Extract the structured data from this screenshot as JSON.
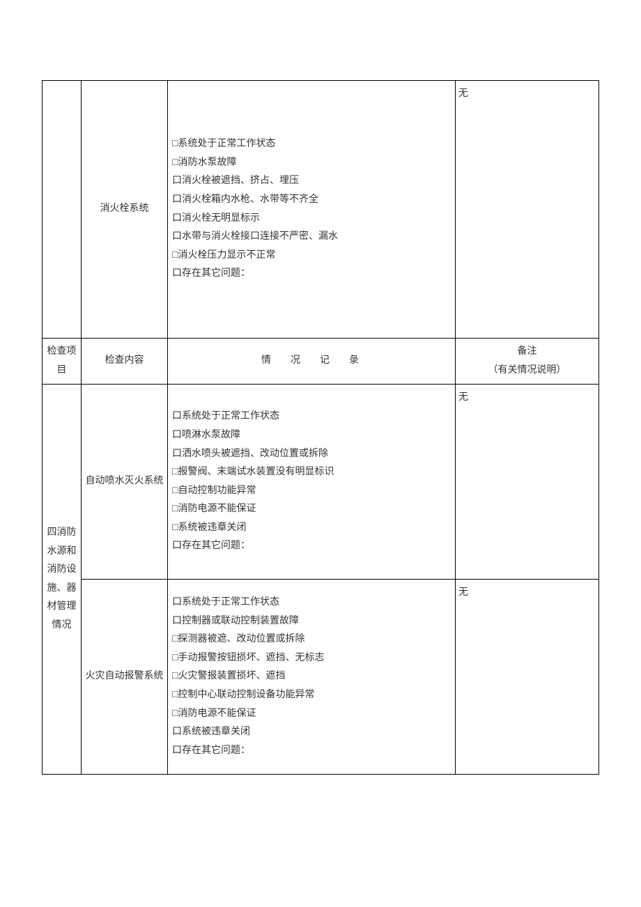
{
  "section_label_partial": "",
  "row1": {
    "content": "消火栓系统",
    "items": [
      "□系统处于正常工作状态",
      "□消防水泵故障",
      "口消火栓被遮挡、挤占、埋压",
      "口消火栓箱内水枪、水带等不齐全",
      "口消火栓无明显标示",
      "口水带与消火栓接口连接不严密、漏水",
      "□消火栓压力显示不正常",
      "口存在其它问题："
    ],
    "remark": "无"
  },
  "headers": {
    "project": "检查项目",
    "content": "检查内容",
    "record": "情况记彔",
    "remark_line1": "备注",
    "remark_line2": "（有关情况说明）"
  },
  "section_label_full": "四消防水源和消防设施、器材管理情况",
  "row2": {
    "content": "自动喷水灭火系统",
    "items": [
      "口系统处于正常工作状态",
      "口喷淋水泵故障",
      "口洒水喷头被遮挡、改动位置或拆除",
      "□报警阀、末端试水装置没有明显标识",
      "□自动控制功能异常",
      "□消防电源不能保证",
      "□系统被违章关闭",
      "口存在其它问题："
    ],
    "remark": "无"
  },
  "row3": {
    "content": "火灾自动报警系统",
    "items": [
      "口系统处于正常工作状态",
      "口控制器或联动控制装置故障",
      "□探测器被遮、改动位置或拆除",
      "□手动报警按钮损坏、遮挡、无标志",
      "□火灾警报装置损坏、遮挡",
      "□控制中心联动控制设备功能异常",
      "□消防电源不能保证",
      "口系统被违章关闭",
      "口存在其它问题："
    ],
    "remark": "无"
  }
}
